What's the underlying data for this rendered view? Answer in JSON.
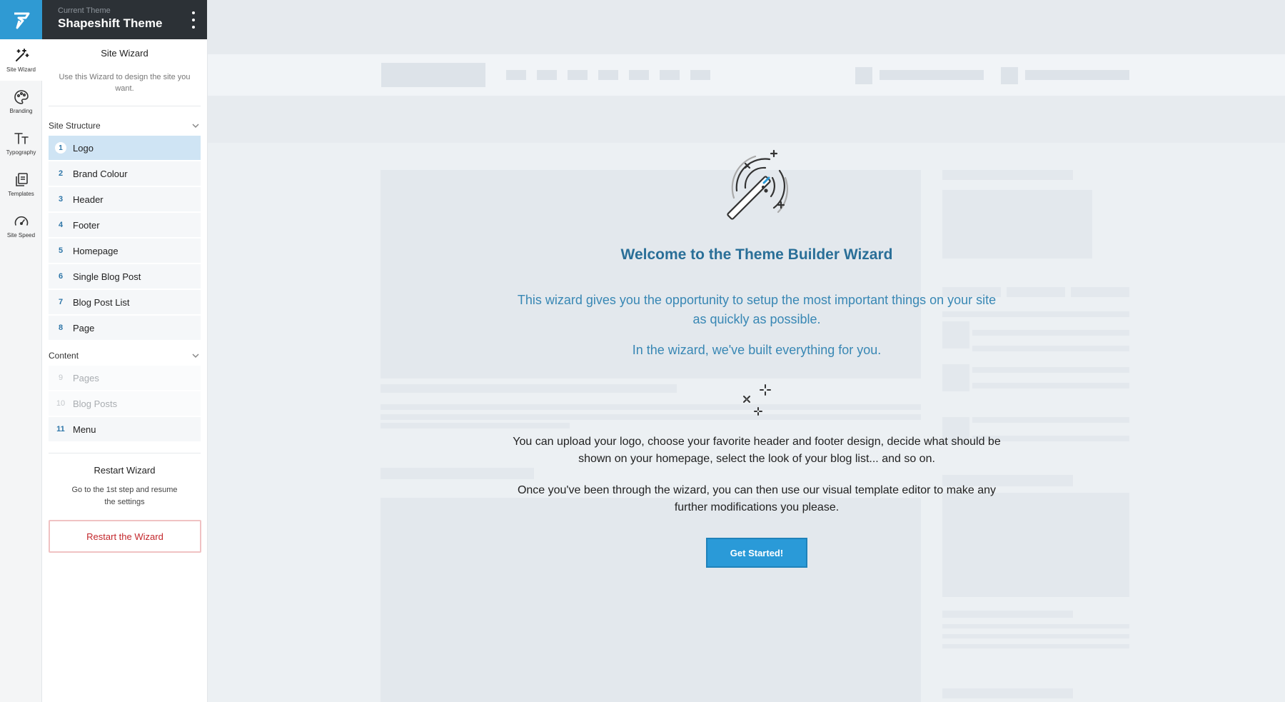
{
  "colors": {
    "brand": "#2f9ad3",
    "header_dark": "#2c3136",
    "active_step": "#cfe4f4",
    "heading_blue": "#2a6f98",
    "lead_blue": "#3887b4",
    "restart_red": "#c3272c",
    "cta_blue": "#2a9ad8"
  },
  "rail": {
    "items": [
      {
        "label": "Site Wizard",
        "icon": "magic-wand-icon",
        "active": true
      },
      {
        "label": "Branding",
        "icon": "palette-icon",
        "active": false
      },
      {
        "label": "Typography",
        "icon": "typography-icon",
        "active": false
      },
      {
        "label": "Templates",
        "icon": "templates-icon",
        "active": false
      },
      {
        "label": "Site Speed",
        "icon": "speedometer-icon",
        "active": false
      }
    ]
  },
  "header": {
    "subtitle": "Current Theme",
    "title": "Shapeshift Theme"
  },
  "wizard": {
    "title": "Site Wizard",
    "description": "Use this Wizard to design the site you want."
  },
  "site_structure": {
    "heading": "Site Structure",
    "steps": [
      {
        "num": "1",
        "label": "Logo",
        "state": "active"
      },
      {
        "num": "2",
        "label": "Brand Colour",
        "state": "normal"
      },
      {
        "num": "3",
        "label": "Header",
        "state": "normal"
      },
      {
        "num": "4",
        "label": "Footer",
        "state": "normal"
      },
      {
        "num": "5",
        "label": "Homepage",
        "state": "normal"
      },
      {
        "num": "6",
        "label": "Single Blog Post",
        "state": "normal"
      },
      {
        "num": "7",
        "label": "Blog Post List",
        "state": "normal"
      },
      {
        "num": "8",
        "label": "Page",
        "state": "normal"
      }
    ]
  },
  "content": {
    "heading": "Content",
    "steps": [
      {
        "num": "9",
        "label": "Pages",
        "state": "disabled"
      },
      {
        "num": "10",
        "label": "Blog Posts",
        "state": "disabled"
      },
      {
        "num": "11",
        "label": "Menu",
        "state": "normal"
      }
    ]
  },
  "restart": {
    "title": "Restart Wizard",
    "description": "Go to the 1st step and resume the settings",
    "button_label": "Restart the Wizard"
  },
  "main": {
    "welcome": "Welcome to the Theme Builder Wizard",
    "lead": "This wizard gives you the opportunity to setup the most important things on your site as quickly as possible.",
    "lead2": "In the wizard, we've built everything for you.",
    "para1": "You can upload your logo, choose your favorite header and footer design, decide what should be shown on your homepage, select the look of your blog list... and so on.",
    "para2": "Once you've been through the wizard, you can then use our visual template editor to make any further modifications you please.",
    "cta_label": "Get Started!"
  }
}
